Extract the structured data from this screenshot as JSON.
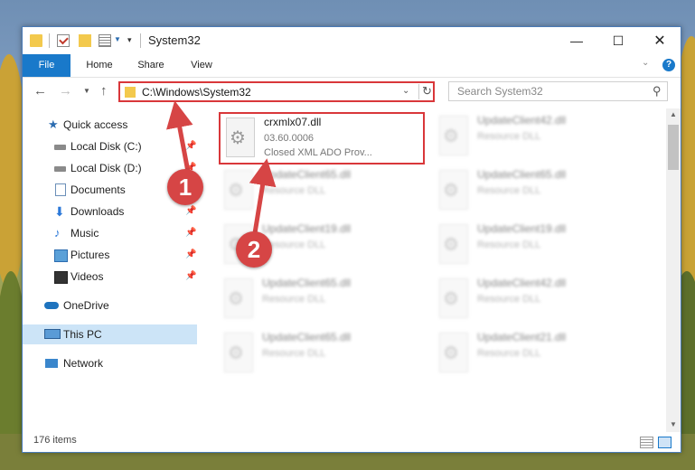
{
  "window": {
    "title": "System32",
    "minimize": "—",
    "maximize": "☐",
    "close": "✕"
  },
  "ribbon": {
    "tabs": [
      "File",
      "Home",
      "Share",
      "View"
    ],
    "help": "?"
  },
  "address": {
    "path": "C:\\Windows\\System32",
    "search_placeholder": "Search System32"
  },
  "nav": {
    "items": [
      {
        "label": "Quick access",
        "icon": "star-icon",
        "pinned": false
      },
      {
        "label": "Local Disk (C:)",
        "icon": "drive-icon",
        "pinned": true
      },
      {
        "label": "Local Disk (D:)",
        "icon": "drive-icon",
        "pinned": true
      },
      {
        "label": "Documents",
        "icon": "documents-icon",
        "pinned": true
      },
      {
        "label": "Downloads",
        "icon": "download-icon",
        "pinned": true
      },
      {
        "label": "Music",
        "icon": "music-icon",
        "pinned": true
      },
      {
        "label": "Pictures",
        "icon": "pictures-icon",
        "pinned": true
      },
      {
        "label": "Videos",
        "icon": "videos-icon",
        "pinned": true
      },
      {
        "label": "OneDrive",
        "icon": "cloud-icon",
        "pinned": false
      },
      {
        "label": "This PC",
        "icon": "computer-icon",
        "pinned": false,
        "selected": true
      },
      {
        "label": "Network",
        "icon": "network-icon",
        "pinned": false
      }
    ]
  },
  "files": [
    {
      "name": "crxmlx07.dll",
      "line2": "03.60.0006",
      "line3": "Closed XML ADO Prov...",
      "highlighted": true
    },
    {
      "name": "UpdateClient42.dll",
      "line2": "Resource DLL"
    },
    {
      "name": "UpdateClient65.dll",
      "line2": "Resource DLL"
    },
    {
      "name": "UpdateClient65.dll",
      "line2": "Resource DLL"
    },
    {
      "name": "UpdateClient19.dll",
      "line2": "Resource DLL"
    },
    {
      "name": "UpdateClient19.dll",
      "line2": "Resource DLL"
    },
    {
      "name": "UpdateClient65.dll",
      "line2": "Resource DLL"
    },
    {
      "name": "UpdateClient42.dll",
      "line2": "Resource DLL"
    },
    {
      "name": "UpdateClient65.dll",
      "line2": "Resource DLL"
    },
    {
      "name": "UpdateClient21.dll",
      "line2": "Resource DLL"
    }
  ],
  "status": {
    "count": "176 items"
  },
  "callouts": [
    "1",
    "2"
  ],
  "colors": {
    "accent": "#1979ca",
    "highlight_box": "#d9373a",
    "callout": "#d64545",
    "selected_nav": "#cce4f7"
  }
}
